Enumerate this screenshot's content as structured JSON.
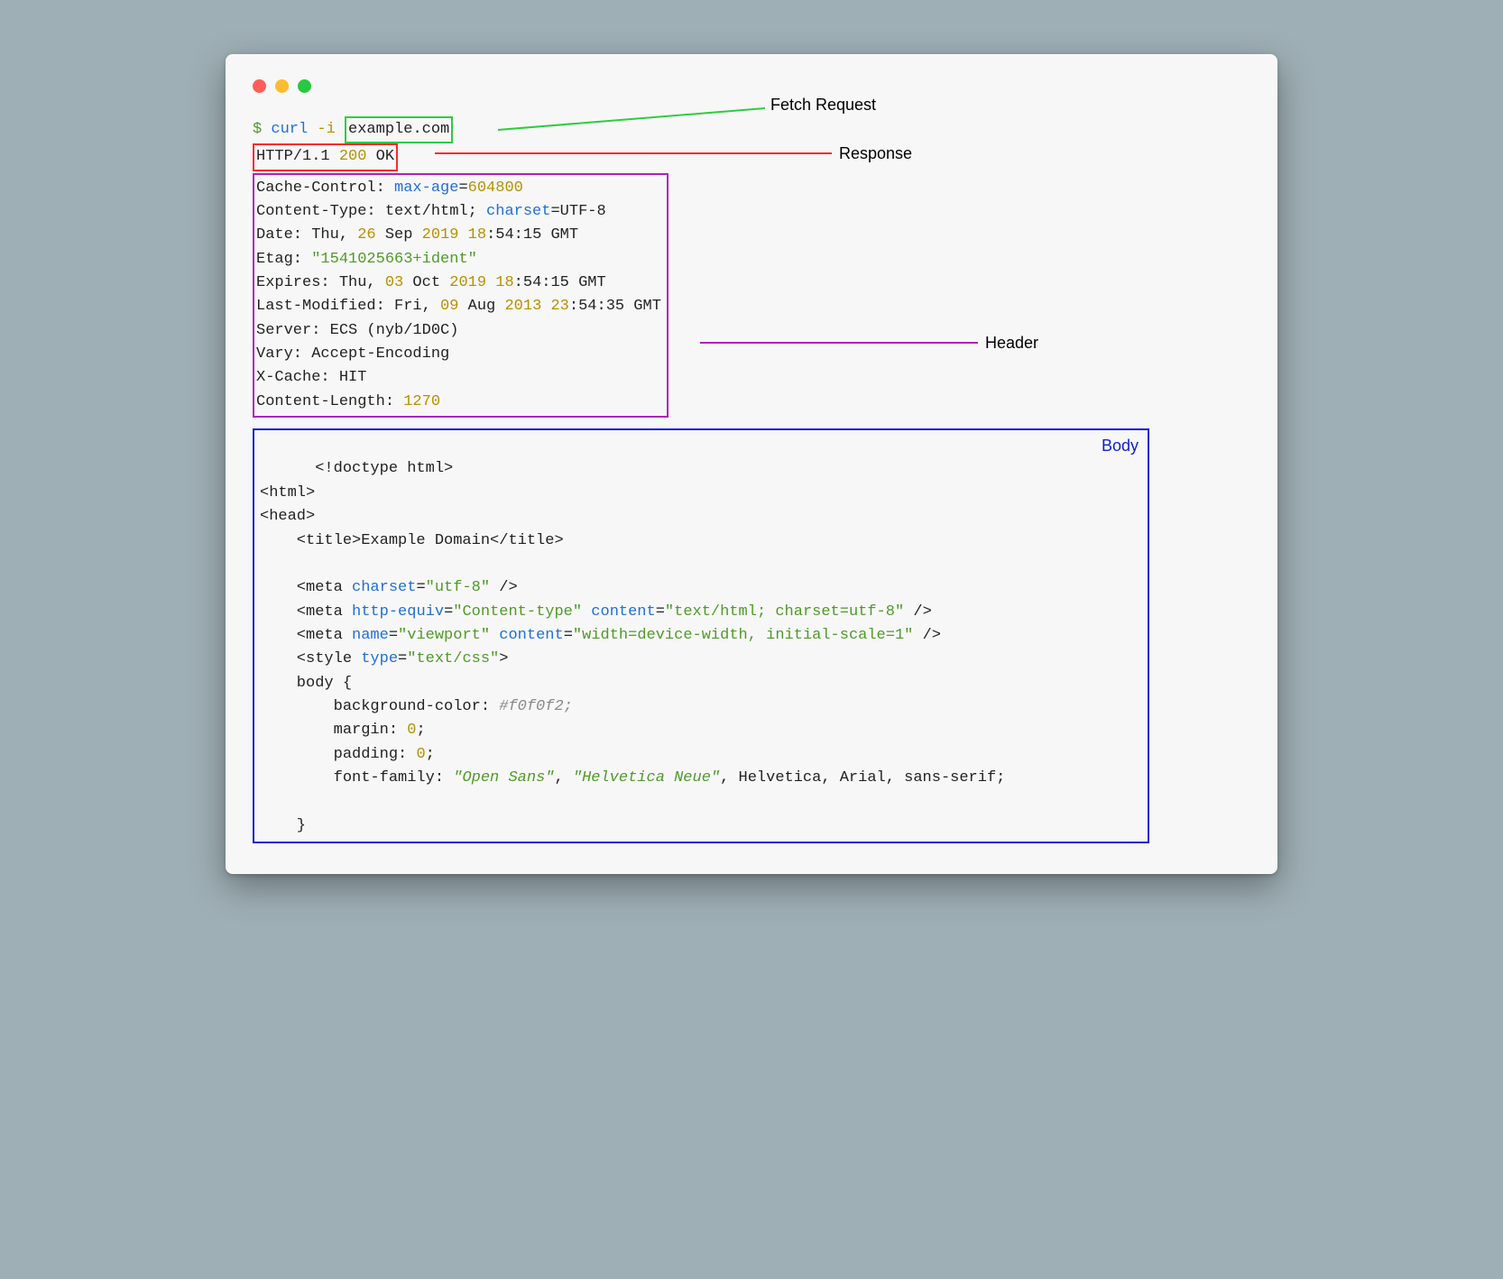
{
  "labels": {
    "fetch": "Fetch Request",
    "response": "Response",
    "header": "Header",
    "body": "Body"
  },
  "prompt": {
    "sigil": "$ ",
    "cmd": "curl",
    "flag": " -i ",
    "url": "example.com"
  },
  "status": {
    "proto": "HTTP/1.1 ",
    "code": "200",
    "text": " OK"
  },
  "hdr": {
    "l0a": "Cache-Control: ",
    "l0b": "max-age",
    "l0c": "=",
    "l0d": "604800",
    "l1a": "Content-Type: text/html; ",
    "l1b": "charset",
    "l1c": "=UTF-8",
    "l2a": "Date: Thu, ",
    "l2b": "26",
    "l2c": " Sep ",
    "l2d": "2019",
    "l2e": " ",
    "l2f": "18",
    "l2g": ":54:15 GMT",
    "l3a": "Etag: ",
    "l3b": "\"1541025663+ident\"",
    "l4a": "Expires: Thu, ",
    "l4b": "03",
    "l4c": " Oct ",
    "l4d": "2019",
    "l4e": " ",
    "l4f": "18",
    "l4g": ":54:15 GMT",
    "l5a": "Last-Modified: Fri, ",
    "l5b": "09",
    "l5c": " Aug ",
    "l5d": "2013",
    "l5e": " ",
    "l5f": "23",
    "l5g": ":54:35 GMT",
    "l6": "Server: ECS (nyb/1D0C)",
    "l7": "Vary: Accept-Encoding",
    "l8": "X-Cache: HIT",
    "l9a": "Content-Length: ",
    "l9b": "1270"
  },
  "body": {
    "l0": "<!doctype html>",
    "l1": "<html>",
    "l2": "<head>",
    "l3a": "    <title>",
    "l3b": "Example Domain",
    "l3c": "</title>",
    "blank": "",
    "l5a": "    <meta ",
    "l5b": "charset",
    "l5c": "=",
    "l5d": "\"utf-8\"",
    "l5e": " />",
    "l6a": "    <meta ",
    "l6b": "http-equiv",
    "l6c": "=",
    "l6d": "\"Content-type\"",
    "l6e": " ",
    "l6f": "content",
    "l6g": "=",
    "l6h": "\"text/html; charset=utf-8\"",
    "l6i": " />",
    "l7a": "    <meta ",
    "l7b": "name",
    "l7c": "=",
    "l7d": "\"viewport\"",
    "l7e": " ",
    "l7f": "content",
    "l7g": "=",
    "l7h": "\"width=device-width, initial-scale=1\"",
    "l7i": " />",
    "l8a": "    <style ",
    "l8b": "type",
    "l8c": "=",
    "l8d": "\"text/css\"",
    "l8e": ">",
    "l9": "    body {",
    "l10a": "        background-color: ",
    "l10b": "#f0f0f2;",
    "l11a": "        margin: ",
    "l11b": "0",
    ";": ";",
    "l12a": "        padding: ",
    "l12b": "0",
    "l13a": "        font-family: ",
    "l13b": "\"Open Sans\"",
    "l13c": ", ",
    "l13d": "\"Helvetica Neue\"",
    "l13e": ", Helvetica, Arial, sans-serif;",
    "l15": "    }"
  }
}
